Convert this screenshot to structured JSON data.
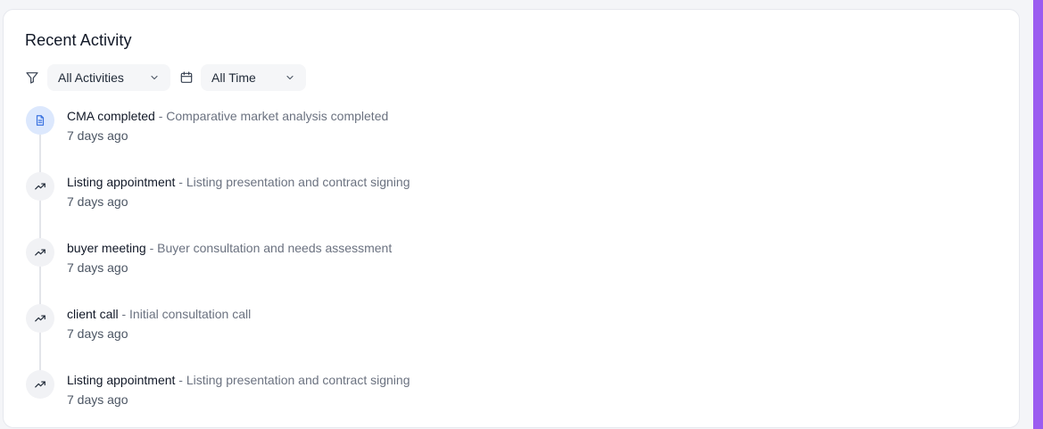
{
  "section": {
    "title": "Recent Activity"
  },
  "filters": {
    "activity_type": "All Activities",
    "time_range": "All Time"
  },
  "activities": [
    {
      "icon": "document-icon",
      "name": "CMA completed",
      "separator": " - ",
      "description": "Comparative market analysis completed",
      "time": "7 days ago"
    },
    {
      "icon": "trending-up-icon",
      "name": "Listing appointment",
      "separator": " - ",
      "description": "Listing presentation and contract signing",
      "time": "7 days ago"
    },
    {
      "icon": "trending-up-icon",
      "name": "buyer meeting",
      "separator": " - ",
      "description": "Buyer consultation and needs assessment",
      "time": "7 days ago"
    },
    {
      "icon": "trending-up-icon",
      "name": "client call",
      "separator": " - ",
      "description": "Initial consultation call",
      "time": "7 days ago"
    },
    {
      "icon": "trending-up-icon",
      "name": "Listing appointment",
      "separator": " - ",
      "description": "Listing presentation and contract signing",
      "time": "7 days ago"
    }
  ],
  "colors": {
    "accent": "#9b5cf0",
    "doc_bubble": "#dce8fd",
    "doc_icon": "#3b73e0"
  }
}
